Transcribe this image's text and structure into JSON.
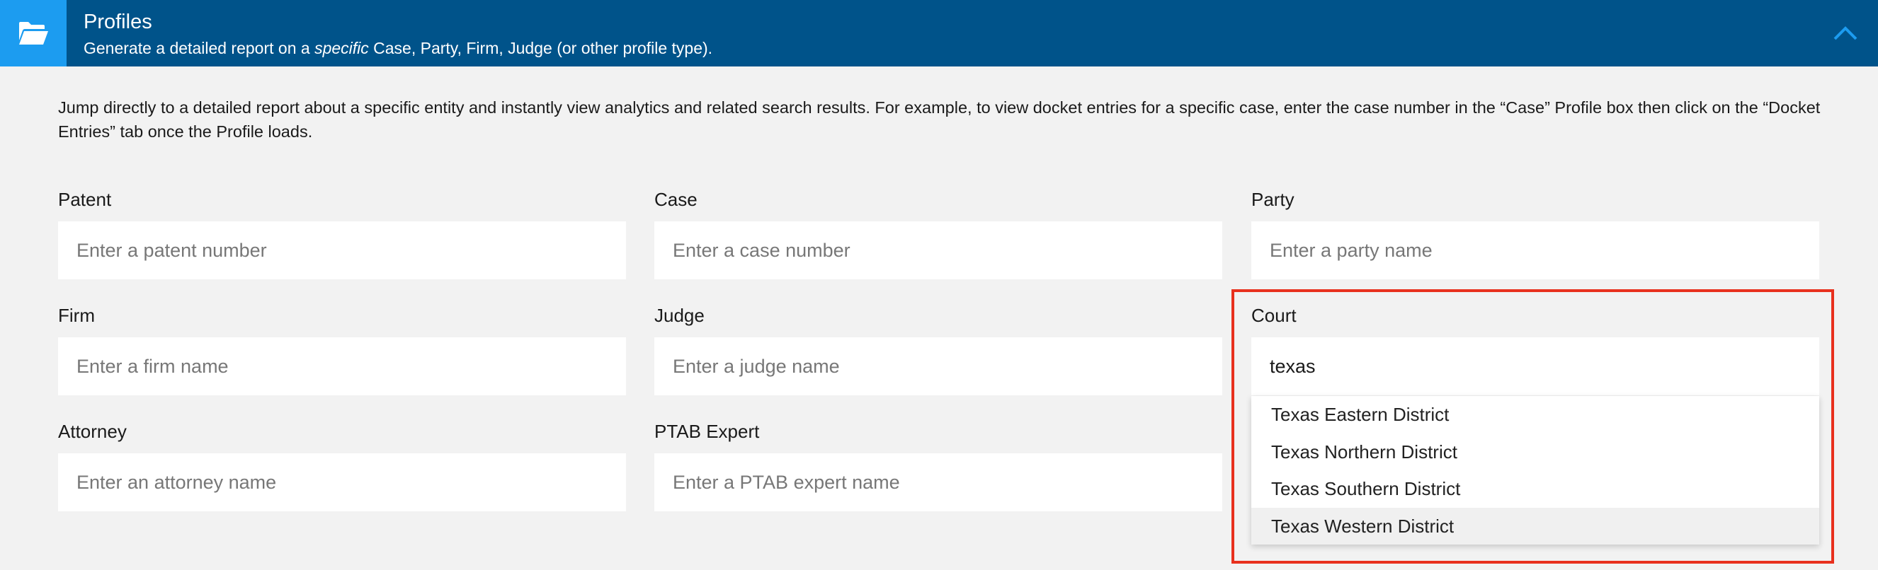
{
  "header": {
    "title": "Profiles",
    "subtitle_before": "Generate a detailed report on a ",
    "subtitle_emphasis": "specific",
    "subtitle_after": " Case, Party, Firm, Judge (or other profile type).",
    "icon": "folder-open-icon",
    "collapse_icon": "chevron-up-icon",
    "colors": {
      "header_bg": "#00538a",
      "icon_bg": "#1c9cf0",
      "highlight": "#e8311e"
    }
  },
  "intro": "Jump directly to a detailed report about a specific entity and instantly view analytics and related search results. For example, to view docket entries for a specific case, enter the case number in the “Case” Profile box then click on the “Docket Entries” tab once the Profile loads.",
  "fields": {
    "patent": {
      "label": "Patent",
      "placeholder": "Enter a patent number",
      "value": ""
    },
    "case": {
      "label": "Case",
      "placeholder": "Enter a case number",
      "value": ""
    },
    "party": {
      "label": "Party",
      "placeholder": "Enter a party name",
      "value": ""
    },
    "firm": {
      "label": "Firm",
      "placeholder": "Enter a firm name",
      "value": ""
    },
    "judge": {
      "label": "Judge",
      "placeholder": "Enter a judge name",
      "value": ""
    },
    "court": {
      "label": "Court",
      "placeholder": "",
      "value": "texas"
    },
    "attorney": {
      "label": "Attorney",
      "placeholder": "Enter an attorney name",
      "value": ""
    },
    "ptab_expert": {
      "label": "PTAB Expert",
      "placeholder": "Enter a PTAB expert name",
      "value": ""
    }
  },
  "court_suggestions": [
    {
      "label": "Texas Eastern District",
      "highlighted": false
    },
    {
      "label": "Texas Northern District",
      "highlighted": false
    },
    {
      "label": "Texas Southern District",
      "highlighted": false
    },
    {
      "label": "Texas Western District",
      "highlighted": true
    }
  ]
}
